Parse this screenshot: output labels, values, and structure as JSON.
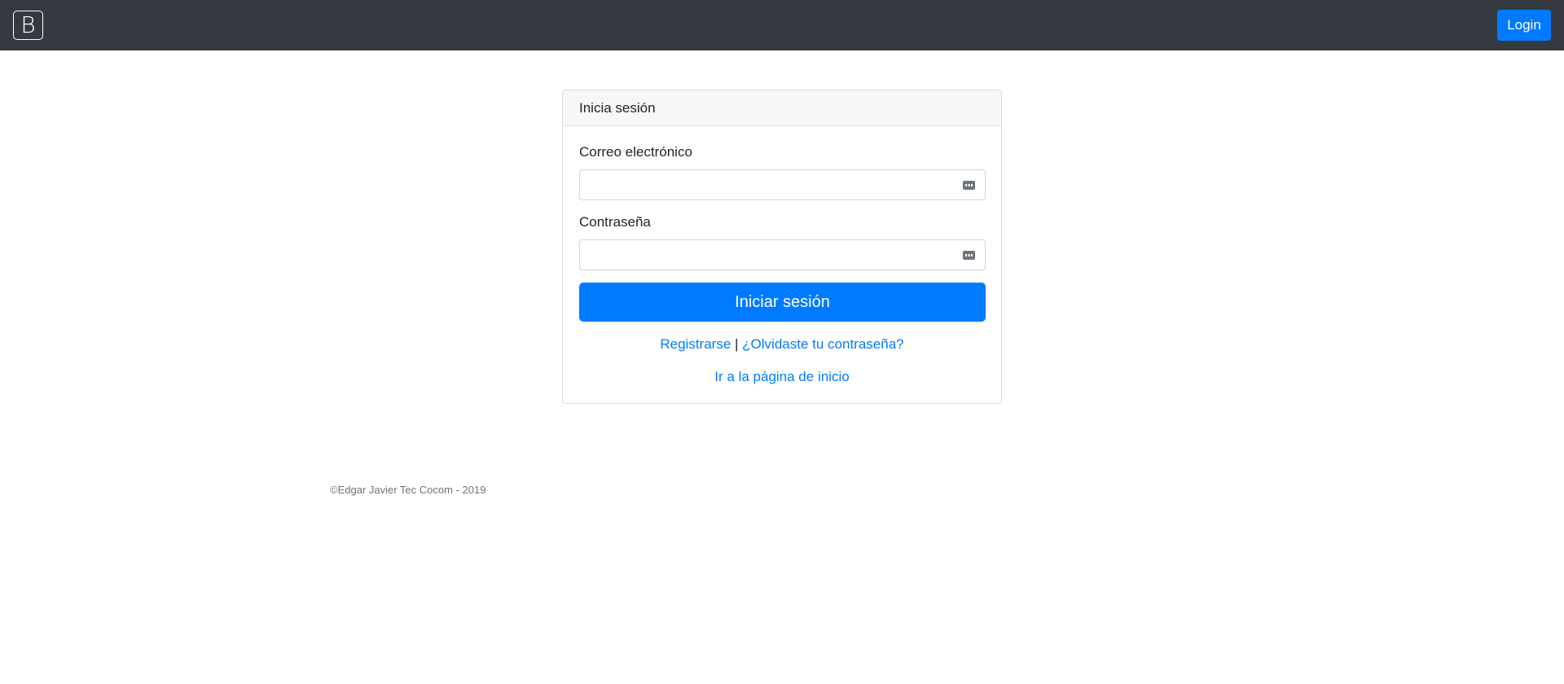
{
  "navbar": {
    "brand_letter": "B",
    "login_label": "Login",
    "background_color": "#343a40",
    "accent_color": "#007bff"
  },
  "login_card": {
    "title": "Inicia sesión",
    "email_label": "Correo electrónico",
    "email_value": "",
    "password_label": "Contraseña",
    "password_value": "",
    "submit_label": "Iniciar sesión",
    "register_link": "Registrarse",
    "separator": "|",
    "forgot_link": "¿Olvidaste tu contraseña?",
    "home_link": "Ir a la página de inicio"
  },
  "footer": {
    "copyright": "©Edgar Javier Tec Cocom - 2019"
  }
}
